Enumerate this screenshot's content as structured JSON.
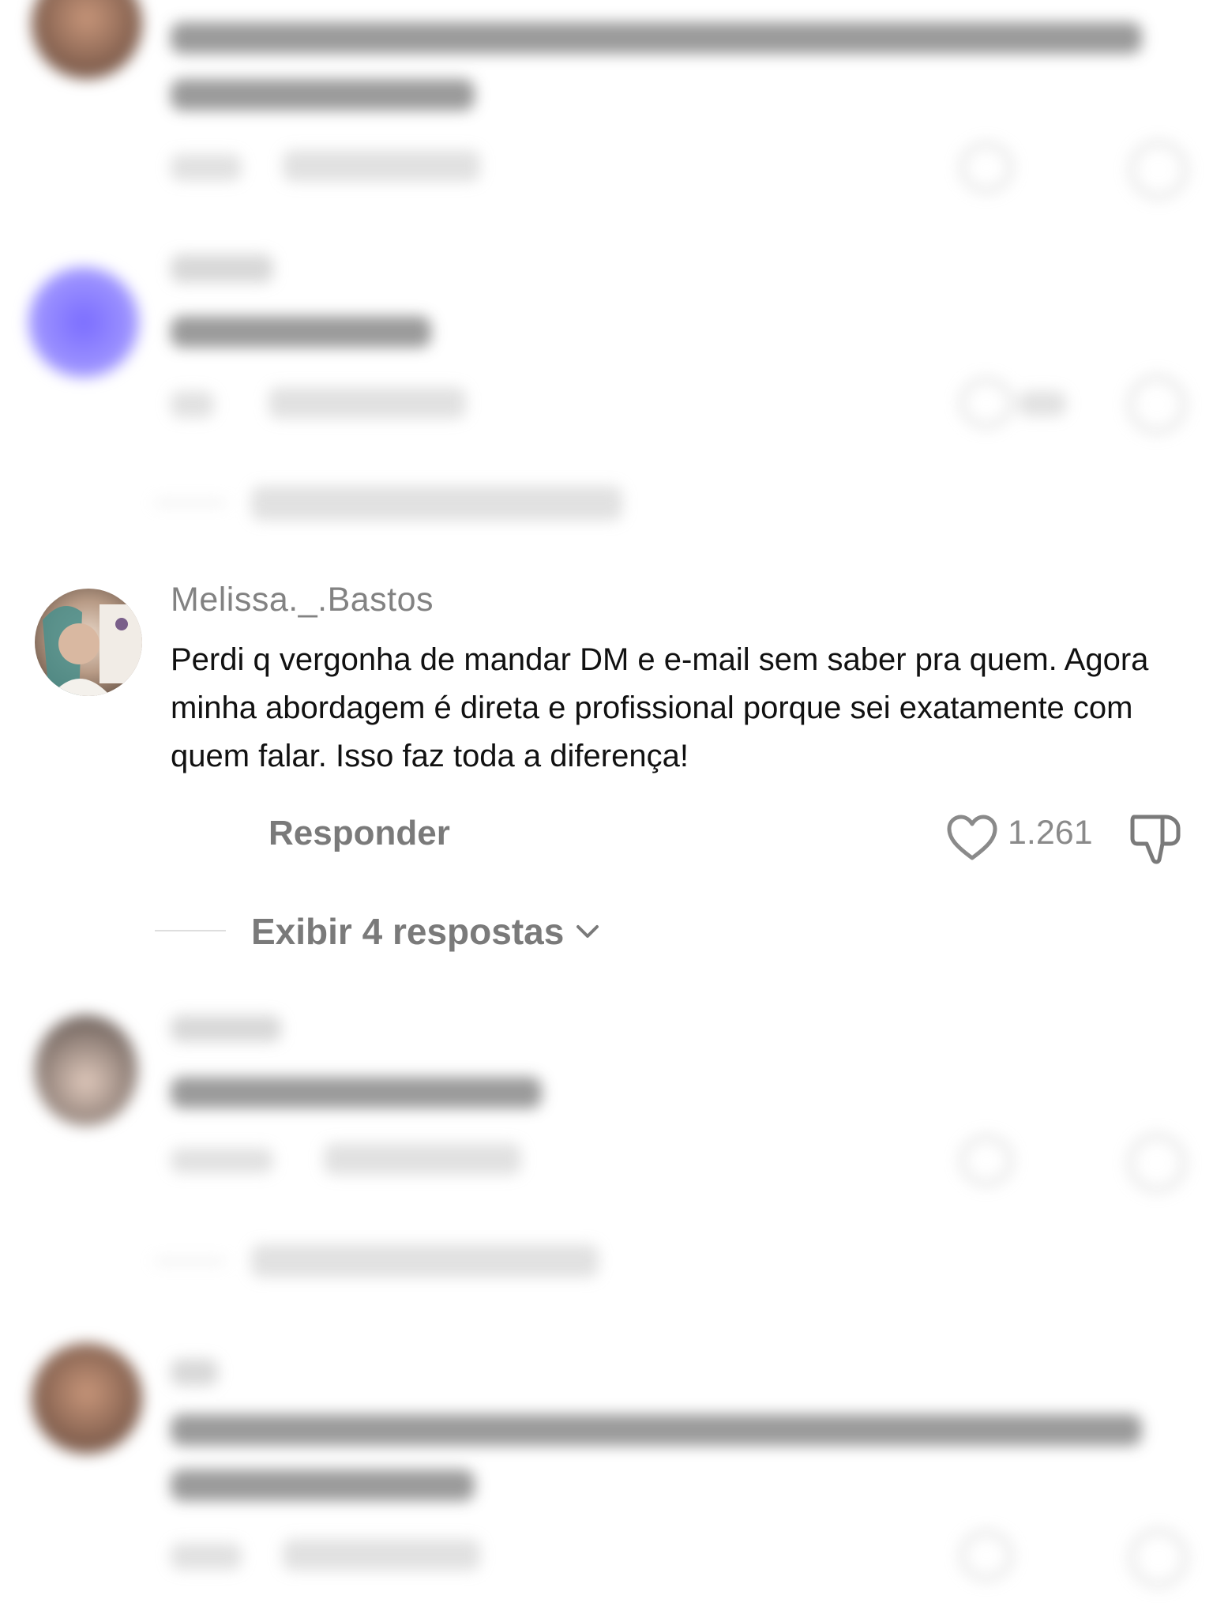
{
  "comment": {
    "username": "Melissa._.Bastos",
    "text": "Perdi q vergonha de mandar DM e e-mail sem saber pra quem. Agora minha abordagem é direta e profissional porque sei exatamente com quem falar. Isso faz toda a diferença!",
    "reply_label": "Responder",
    "like_count": "1.261",
    "view_replies_label": "Exibir 4 respostas"
  },
  "colors": {
    "username": "#828282",
    "text": "#111111",
    "action": "#7a7a7a"
  },
  "icons": [
    "heart-outline-icon",
    "thumbs-down-icon",
    "chevron-down-icon"
  ]
}
